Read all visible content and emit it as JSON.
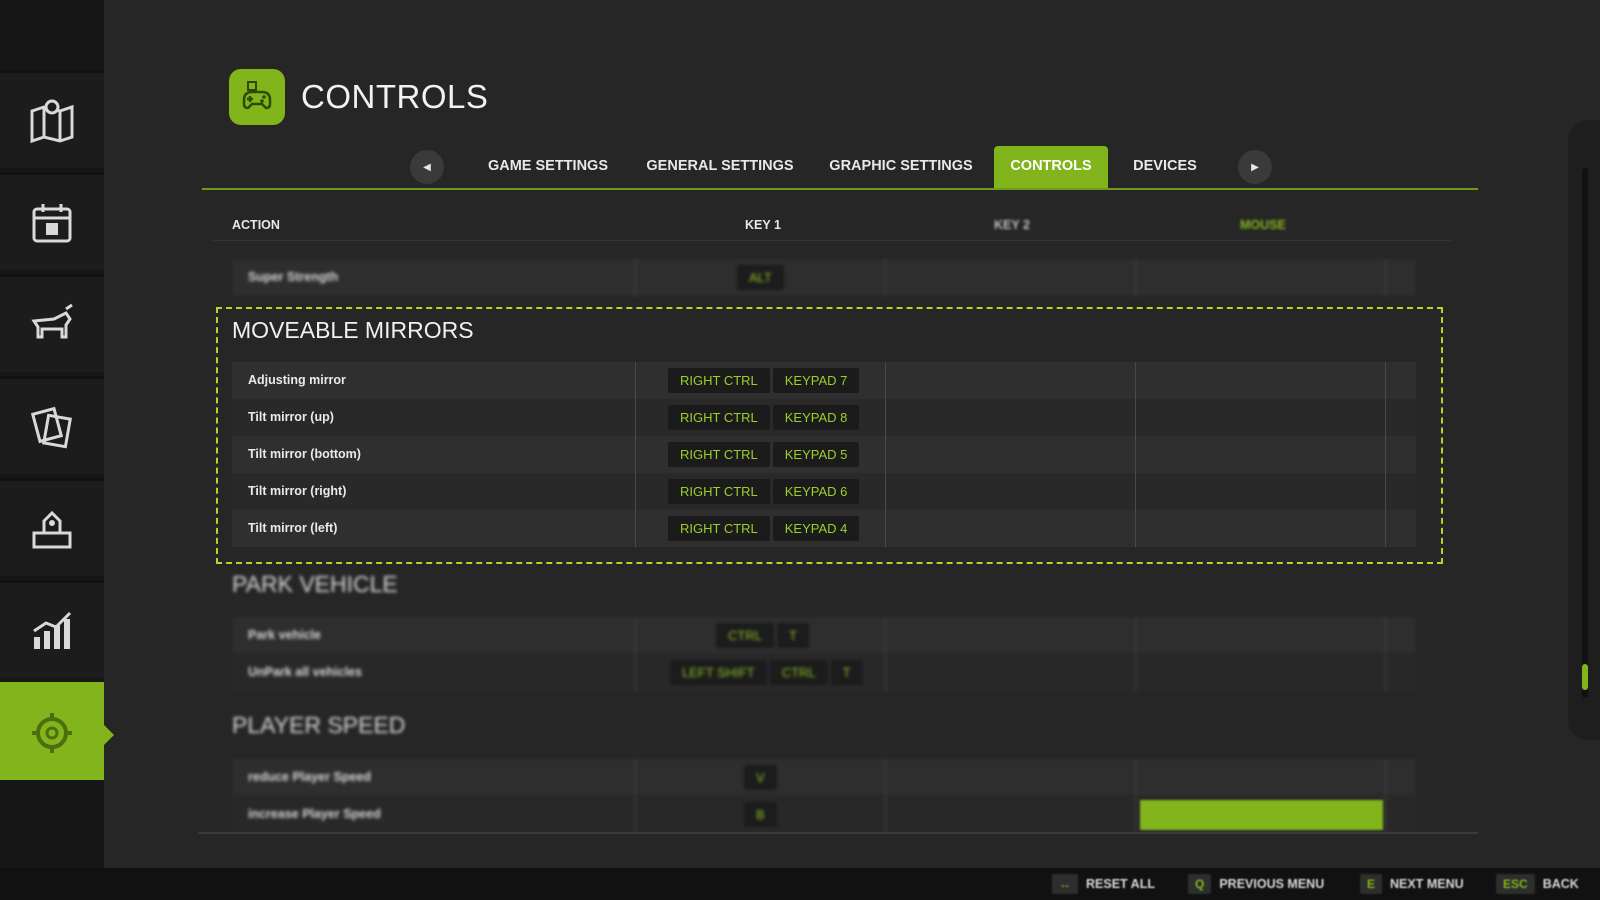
{
  "header": {
    "title": "CONTROLS",
    "icon": "gamepad-icon"
  },
  "sidebar": {
    "items": [
      {
        "icon": "map-icon"
      },
      {
        "icon": "calendar-icon"
      },
      {
        "icon": "animals-icon"
      },
      {
        "icon": "contracts-icon"
      },
      {
        "icon": "production-icon"
      },
      {
        "icon": "statistics-icon"
      },
      {
        "icon": "settings-icon",
        "active": true
      }
    ]
  },
  "tabs": {
    "prev_arrow": "◀",
    "next_arrow": "▶",
    "items": [
      "GAME SETTINGS",
      "GENERAL SETTINGS",
      "GRAPHIC SETTINGS",
      "CONTROLS",
      "DEVICES"
    ],
    "active": "CONTROLS"
  },
  "columns": {
    "action": "ACTION",
    "key1": "KEY 1",
    "key2": "KEY 2",
    "mouse": "MOUSE"
  },
  "rows_top": [
    {
      "label": "Super Strength",
      "key1": [
        "ALT"
      ]
    }
  ],
  "sections": [
    {
      "title": "MOVEABLE MIRRORS",
      "rows": [
        {
          "label": "Adjusting mirror",
          "key1": [
            "RIGHT CTRL",
            "KEYPAD 7"
          ]
        },
        {
          "label": "Tilt mirror (up)",
          "key1": [
            "RIGHT CTRL",
            "KEYPAD 8"
          ]
        },
        {
          "label": "Tilt mirror (bottom)",
          "key1": [
            "RIGHT CTRL",
            "KEYPAD 5"
          ]
        },
        {
          "label": "Tilt mirror (right)",
          "key1": [
            "RIGHT CTRL",
            "KEYPAD 6"
          ]
        },
        {
          "label": "Tilt mirror (left)",
          "key1": [
            "RIGHT CTRL",
            "KEYPAD 4"
          ]
        }
      ]
    },
    {
      "title": "PARK VEHICLE",
      "rows": [
        {
          "label": "Park vehicle",
          "key1": [
            "CTRL",
            "T"
          ]
        },
        {
          "label": "UnPark all vehicles",
          "key1": [
            "LEFT SHIFT",
            "CTRL",
            "T"
          ]
        }
      ]
    },
    {
      "title": "PLAYER SPEED",
      "rows": [
        {
          "label": "reduce Player Speed",
          "key1": [
            "V"
          ]
        },
        {
          "label": "increase Player Speed",
          "key1": [
            "B"
          ]
        }
      ]
    }
  ],
  "footer": [
    {
      "key": "↔",
      "label": "RESET ALL"
    },
    {
      "key": "Q",
      "label": "PREVIOUS MENU"
    },
    {
      "key": "E",
      "label": "NEXT MENU"
    },
    {
      "key": "ESC",
      "label": "BACK"
    }
  ],
  "colors": {
    "accent": "#82b51c",
    "background": "#262626",
    "sidebar": "#161616"
  }
}
